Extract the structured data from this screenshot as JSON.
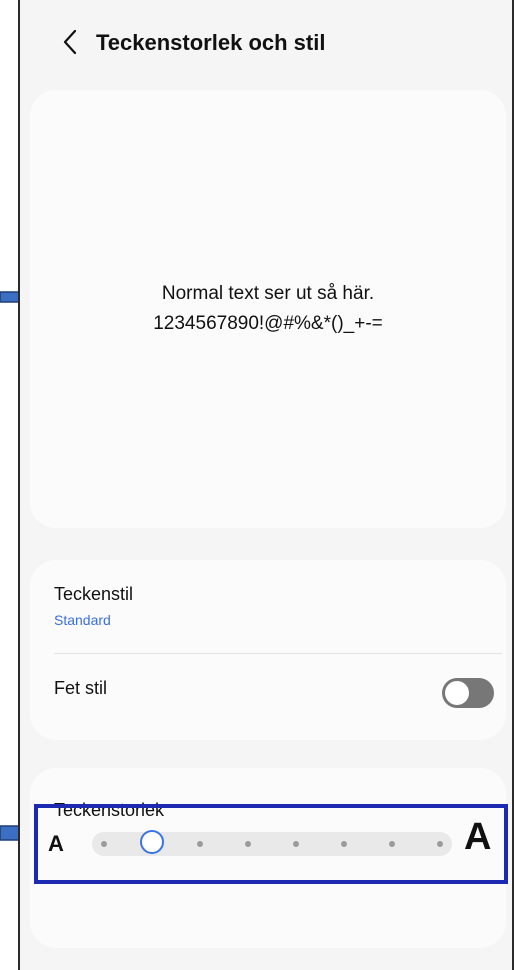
{
  "header": {
    "title": "Teckenstorlek och stil",
    "back_icon": "chevron-left-icon"
  },
  "preview": {
    "line1": "Normal text ser ut så här.",
    "line2": "1234567890!@#%&*()_+-="
  },
  "settings": {
    "font_style": {
      "label": "Teckenstil",
      "value": "Standard"
    },
    "bold": {
      "label": "Fet stil",
      "enabled": false
    }
  },
  "font_size": {
    "label": "Teckenstorlek",
    "small_label": "A",
    "large_label": "A",
    "steps": 8,
    "selected_step": 2
  },
  "colors": {
    "accent": "#3a73e6",
    "link_text": "#3a6fd8",
    "highlight_box": "#1b2ab0",
    "annotation_arrow": "#3b6fc4",
    "toggle_off": "#777777"
  }
}
